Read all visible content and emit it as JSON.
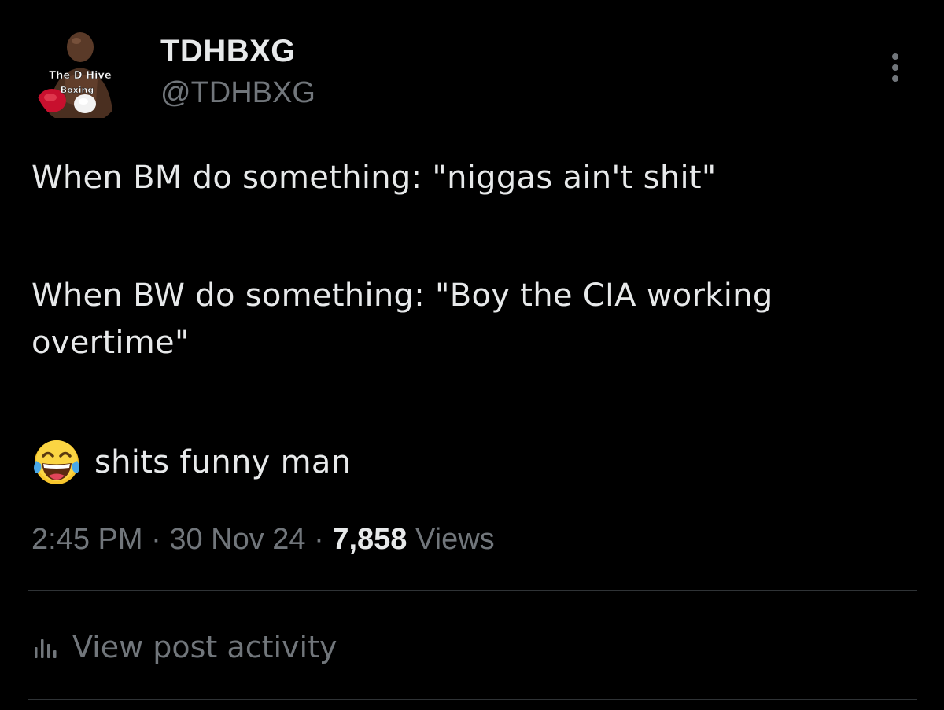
{
  "post": {
    "display_name": "TDHBXG",
    "handle": "@TDHBXG",
    "avatar": {
      "icon": "avatar-boxer-image",
      "logo_text_line1": "The D Hive",
      "logo_text_line2": "Boxing"
    },
    "more_icon": "more-options-icon",
    "text": {
      "line1": "When BM do something: \"niggas ain't shit\"",
      "line2": "When BW do something: \"Boy the CIA working overtime\"",
      "line3_emoji": "face-with-tears-of-joy",
      "line3": "shits funny man"
    },
    "meta": {
      "time": "2:45 PM",
      "date": "30 Nov 24",
      "separator": "·",
      "views_count": "7,858",
      "views_label": "Views"
    },
    "activity": {
      "icon": "bar-chart-icon",
      "label": "View post activity"
    }
  },
  "colors": {
    "background": "#000000",
    "primary_text": "#e7e9ea",
    "secondary_text": "#71767b",
    "divider": "#2f3336"
  }
}
